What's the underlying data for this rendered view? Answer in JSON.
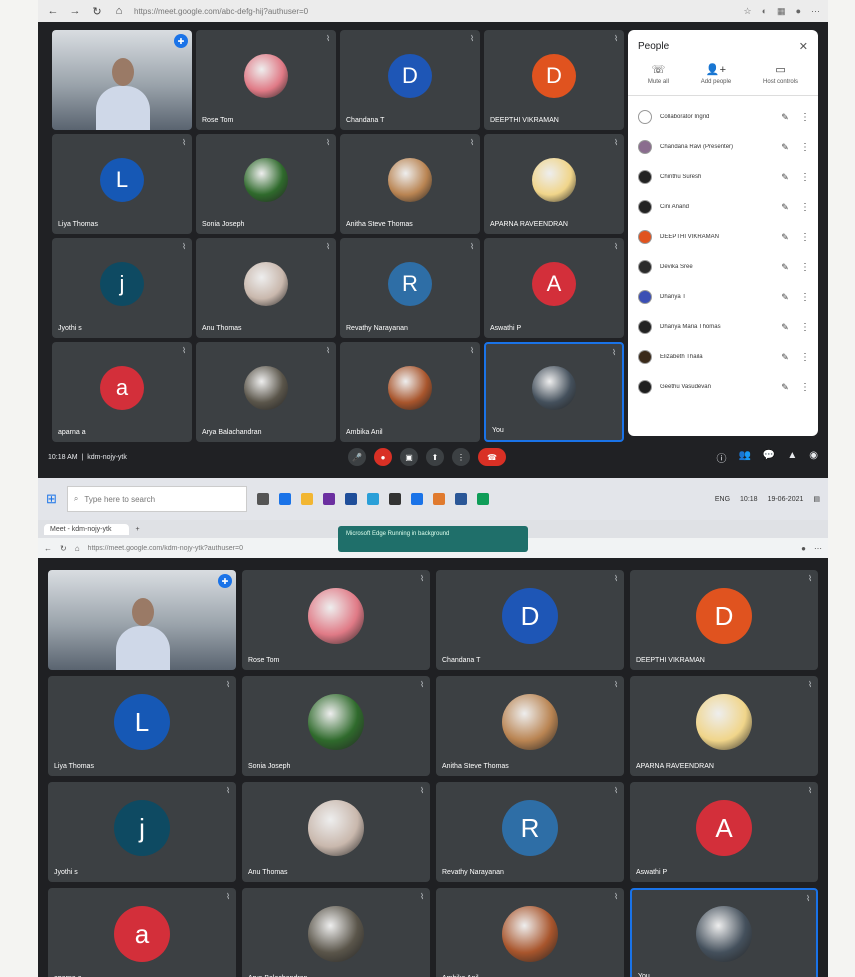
{
  "browser": {
    "url": "https://meet.google.com/abc-defg-hij?authuser=0",
    "nav": {
      "back": "←",
      "forward": "→",
      "reload": "↻",
      "home": "⌂"
    }
  },
  "meet": {
    "tiles": [
      {
        "name": "",
        "type": "self",
        "muted": false
      },
      {
        "name": "Rose Tom",
        "type": "photo",
        "color": "#e07a86"
      },
      {
        "name": "Chandana T",
        "type": "letter",
        "letter": "D",
        "color": "#1e56b6"
      },
      {
        "name": "DEEPTHI VIKRAMAN",
        "type": "letter",
        "letter": "D",
        "color": "#e0531f"
      },
      {
        "name": "Liya Thomas",
        "type": "letter",
        "letter": "L",
        "color": "#1658b5"
      },
      {
        "name": "Sonia Joseph",
        "type": "photo",
        "color": "#2f6a2c"
      },
      {
        "name": "Anitha Steve Thomas",
        "type": "photo",
        "color": "#b98452"
      },
      {
        "name": "APARNA RAVEENDRAN",
        "type": "photo",
        "color": "#f0d58a"
      },
      {
        "name": "Jyothi s",
        "type": "letter",
        "letter": "j",
        "color": "#0e4a62"
      },
      {
        "name": "Anu Thomas",
        "type": "photo",
        "color": "#c9b8ad"
      },
      {
        "name": "Revathy Narayanan",
        "type": "letter",
        "letter": "R",
        "color": "#2e6ea6"
      },
      {
        "name": "Aswathi P",
        "type": "letter",
        "letter": "A",
        "color": "#d32f3a"
      },
      {
        "name": "aparna a",
        "type": "letter",
        "letter": "a",
        "color": "#d32f3a"
      },
      {
        "name": "Arya Balachandran",
        "type": "photo",
        "color": "#5a554a"
      },
      {
        "name": "Ambika Anil",
        "type": "photo",
        "color": "#a8552c"
      },
      {
        "name": "You",
        "type": "you",
        "color": "#44505c"
      }
    ],
    "people_panel": {
      "title": "People",
      "close": "✕",
      "actions": [
        {
          "icon": "☏",
          "label": "Mute all"
        },
        {
          "icon": "👤+",
          "label": "Add people"
        },
        {
          "icon": "▭",
          "label": "Host controls"
        }
      ],
      "people": [
        {
          "name": "Collaborator Ingrid",
          "color": "#ffffff"
        },
        {
          "name": "Chandana Ravi (Presenter)",
          "color": "#8a6d8e"
        },
        {
          "name": "Chinthu Suresh",
          "color": "#222222"
        },
        {
          "name": "Cini Anand",
          "color": "#222222"
        },
        {
          "name": "DEEPTHI VIKRAMAN",
          "color": "#e0531f"
        },
        {
          "name": "Devika Sree",
          "color": "#2b2b2b"
        },
        {
          "name": "Dhanya T",
          "color": "#3b4fb4"
        },
        {
          "name": "Dhanya Maria Thomas",
          "color": "#222222"
        },
        {
          "name": "Elizabeth Thaila",
          "color": "#3a2a1a"
        },
        {
          "name": "Geethu Vasudevan",
          "color": "#1e1e1e"
        }
      ]
    },
    "controls": {
      "time": "10:18 AM",
      "meeting_code": "kdm-nojy-ytk",
      "icons": [
        "🎤",
        "●",
        "▣",
        "⬆",
        "⋮",
        "☎"
      ],
      "right_icons": [
        "ⓘ",
        "👥",
        "💬",
        "▲",
        "◉"
      ]
    }
  },
  "taskbar": {
    "search_placeholder": "Type here to search",
    "tray_text": "ENG",
    "clock": "10:18",
    "date": "19-06-2021"
  },
  "window2": {
    "tab_label": "Meet - kdm-nojy-ytk",
    "toast": "Microsoft Edge\nRunning in background",
    "url": "https://meet.google.com/kdm-nojy-ytk?authuser=0"
  }
}
